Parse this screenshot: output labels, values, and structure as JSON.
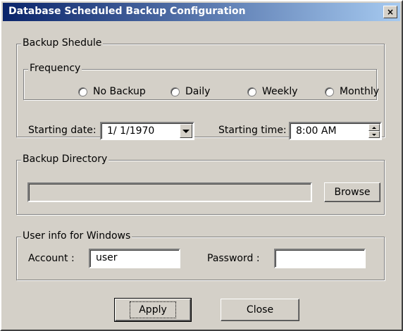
{
  "window": {
    "title": "Database Scheduled Backup Configuration",
    "close_label": "×"
  },
  "schedule": {
    "legend": "Backup Shedule",
    "frequency": {
      "legend": "Frequency",
      "options": [
        "No Backup",
        "Daily",
        "Weekly",
        "Monthly"
      ]
    },
    "start_date_label": "Starting date:",
    "start_date_value": "1/ 1/1970",
    "start_time_label": "Starting time:",
    "start_time_value": "8:00 AM"
  },
  "directory": {
    "legend": "Backup Directory",
    "path_value": "",
    "browse_label": "Browse"
  },
  "user": {
    "legend": "User info for Windows",
    "account_label": "Account :",
    "account_value": "user",
    "password_label": "Password :",
    "password_value": ""
  },
  "buttons": {
    "apply": "Apply",
    "close": "Close"
  }
}
